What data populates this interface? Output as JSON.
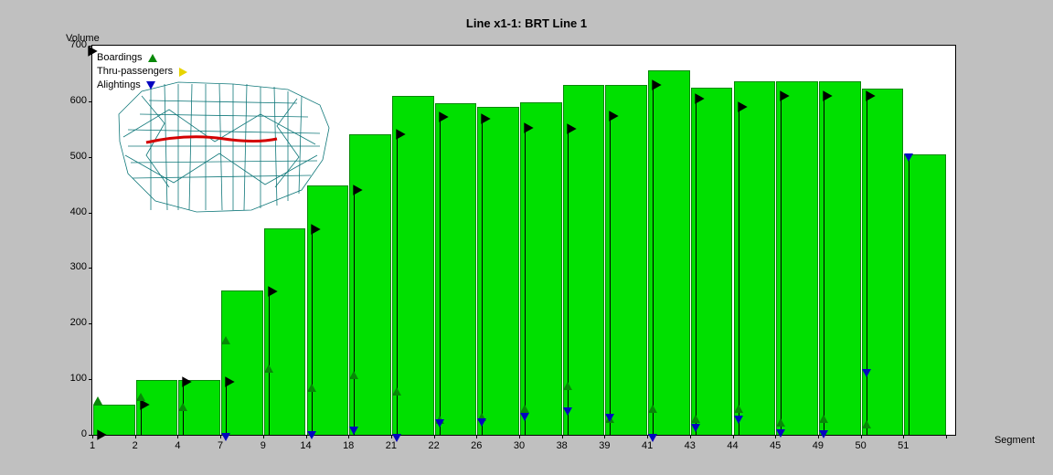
{
  "title": "Line x1-1: BRT Line 1",
  "ylabel": "Volume",
  "xlabel": "Segment",
  "legend": {
    "boardings": "Boardings",
    "thru": "Thru-passengers",
    "alightings": "Alightings"
  },
  "chart_data": {
    "type": "bar",
    "xlabel": "Segment",
    "ylabel": "Volume",
    "title": "Line x1-1: BRT Line 1",
    "ylim": [
      0,
      700
    ],
    "categories": [
      "1",
      "2",
      "4",
      "7",
      "9",
      "14",
      "18",
      "21",
      "22",
      "26",
      "30",
      "38",
      "39",
      "41",
      "43",
      "44",
      "45",
      "49",
      "50",
      "51"
    ],
    "series": [
      {
        "name": "Volume (bars)",
        "style": "bar",
        "values": [
          55,
          98,
          98,
          260,
          372,
          448,
          540,
          610,
          596,
          590,
          598,
          629,
          629,
          655,
          624,
          636,
          636,
          636,
          622,
          505
        ]
      },
      {
        "name": "Boardings",
        "style": "triangle-up",
        "values": [
          55,
          60,
          42,
          163,
          112,
          77,
          100,
          70,
          20,
          25,
          40,
          80,
          22,
          40,
          22,
          40,
          15,
          22,
          12,
          null
        ]
      },
      {
        "name": "Thru-passengers",
        "style": "triangle-right",
        "values": [
          0,
          55,
          95,
          95,
          258,
          370,
          440,
          540,
          572,
          568,
          552,
          550,
          573,
          629,
          604,
          590,
          610,
          610,
          610,
          null
        ]
      },
      {
        "name": "Alightings",
        "style": "triangle-down",
        "values": [
          null,
          null,
          null,
          4,
          null,
          6,
          14,
          2,
          28,
          30,
          40,
          50,
          38,
          2,
          20,
          34,
          10,
          8,
          118,
          506
        ]
      }
    ],
    "legend_position": "top-left",
    "inset_map": true
  }
}
